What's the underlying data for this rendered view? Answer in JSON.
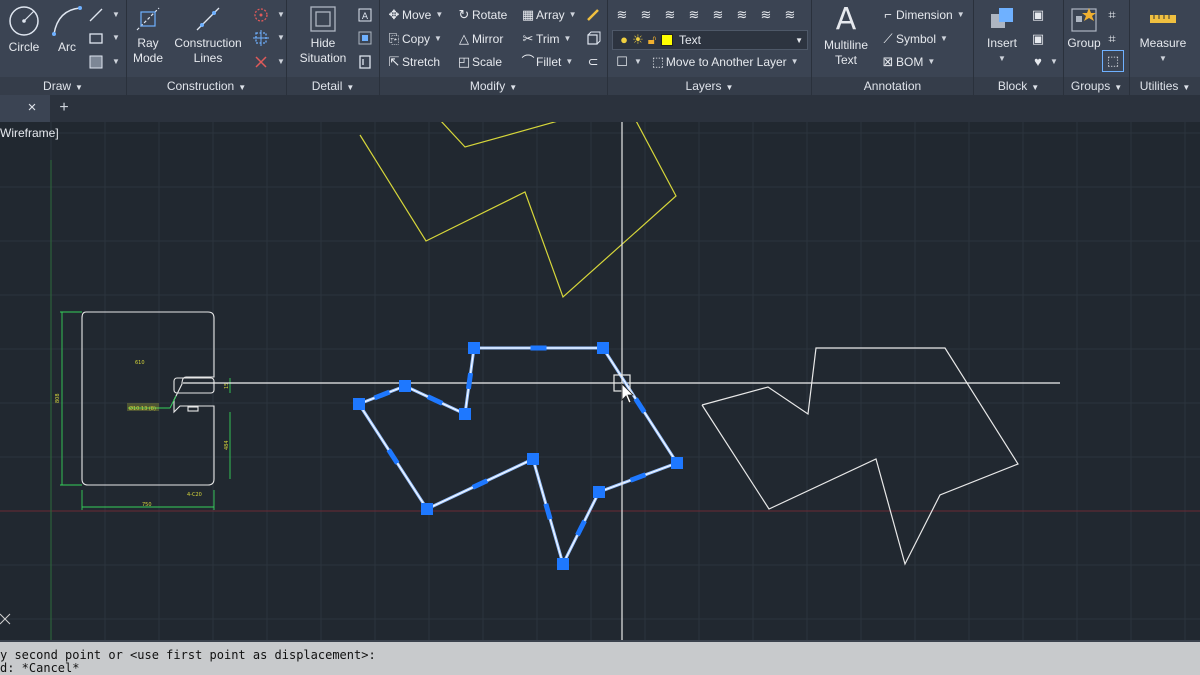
{
  "ribbon": {
    "panels": {
      "draw": {
        "title": "Draw",
        "circle": "Circle",
        "arc": "Arc"
      },
      "construction": {
        "title": "Construction",
        "ray_mode": [
          "Ray",
          "Mode"
        ],
        "construction_lines": [
          "Construction",
          "Lines"
        ]
      },
      "detail": {
        "title": "Detail",
        "hide_situation": [
          "Hide",
          "Situation"
        ]
      },
      "modify": {
        "title": "Modify",
        "move": "Move",
        "rotate": "Rotate",
        "array": "Array",
        "copy": "Copy",
        "mirror": "Mirror",
        "trim": "Trim",
        "stretch": "Stretch",
        "scale": "Scale",
        "fillet": "Fillet"
      },
      "layers": {
        "title": "Layers",
        "current_layer": "Text",
        "current_layer_color": "#ffff00",
        "move_to_layer": "Move to Another Layer"
      },
      "annotation": {
        "title": "Annotation",
        "multiline_text": [
          "Multiline",
          "Text"
        ],
        "dimension": "Dimension",
        "symbol": "Symbol",
        "bom": "BOM"
      },
      "block": {
        "title": "Block",
        "insert": "Insert"
      },
      "groups": {
        "title": "Groups",
        "group": "Group"
      },
      "utilities": {
        "title": "Utilities",
        "measure": "Measure"
      }
    }
  },
  "tabs": {
    "close": "×",
    "add": "+"
  },
  "viewport": {
    "label": "Wireframe]"
  },
  "drawing": {
    "part": {
      "dim_top": "610",
      "dim_left": "808",
      "dim_bottom": "750",
      "note_1": "Ø10.13 (8)",
      "note_2": "4-C20",
      "dim_right": "484",
      "dim_small": "15"
    }
  },
  "colors": {
    "grid": "#2c343e",
    "selection": "#1e78ff",
    "yellow_poly": "#d6d63a",
    "white_poly": "#e8e8e8",
    "dim_green": "#35d15a"
  },
  "command_line": {
    "line1": "y second point or <use first point as displacement>:",
    "line2": "d: *Cancel*"
  }
}
